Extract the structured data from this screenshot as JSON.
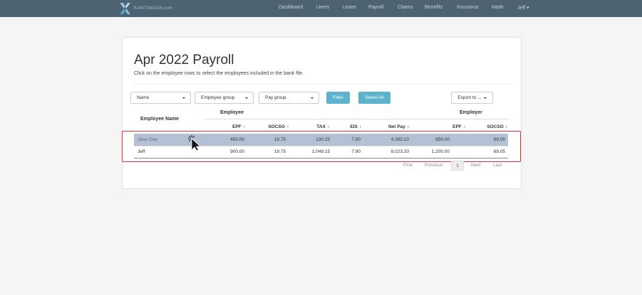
{
  "nav": {
    "brand": "KAKITANGAN.com",
    "items": [
      "Dashboard",
      "Users",
      "Leave",
      "Payroll",
      "Claims",
      "Benefits",
      "Insurance",
      "Hadir",
      "Jeff ▾"
    ]
  },
  "page": {
    "title": "Apr 2022 Payroll",
    "subtitle": "Click on the employee rows to select the employees included in the bank file."
  },
  "filters": {
    "name": "Name",
    "employee_group": "Employee group",
    "pay_group": "Pay group",
    "filter_button": "Filter",
    "select_all_button": "Select All",
    "export_button": "Export to ..."
  },
  "table": {
    "name_header": "Employee Name",
    "group_employee": "Employee",
    "group_employer": "Employer",
    "columns": [
      "EPF",
      "SOCSO",
      "TAX",
      "EIS",
      "Net Pay",
      "EPF",
      "SOCSO"
    ],
    "sort_glyph": "⬍",
    "rows": [
      {
        "name": "Jane Doe",
        "values": [
          "450.00",
          "19.75",
          "130.25",
          "7.90",
          "4,392.10",
          "650.00",
          "69.05"
        ]
      },
      {
        "name": "Jeff",
        "values": [
          "900.00",
          "19.75",
          "1,049.15",
          "7.90",
          "8,023.20",
          "1,200.00",
          "69.05"
        ]
      }
    ]
  },
  "pagination": {
    "first": "First",
    "previous": "Previous",
    "current": "1",
    "next": "Next",
    "last": "Last"
  },
  "colors": {
    "navbar": "#4d6372",
    "selected_row": "#b3c1d5",
    "primary_button": "#5bb4cc",
    "highlight_box": "#e03030"
  }
}
